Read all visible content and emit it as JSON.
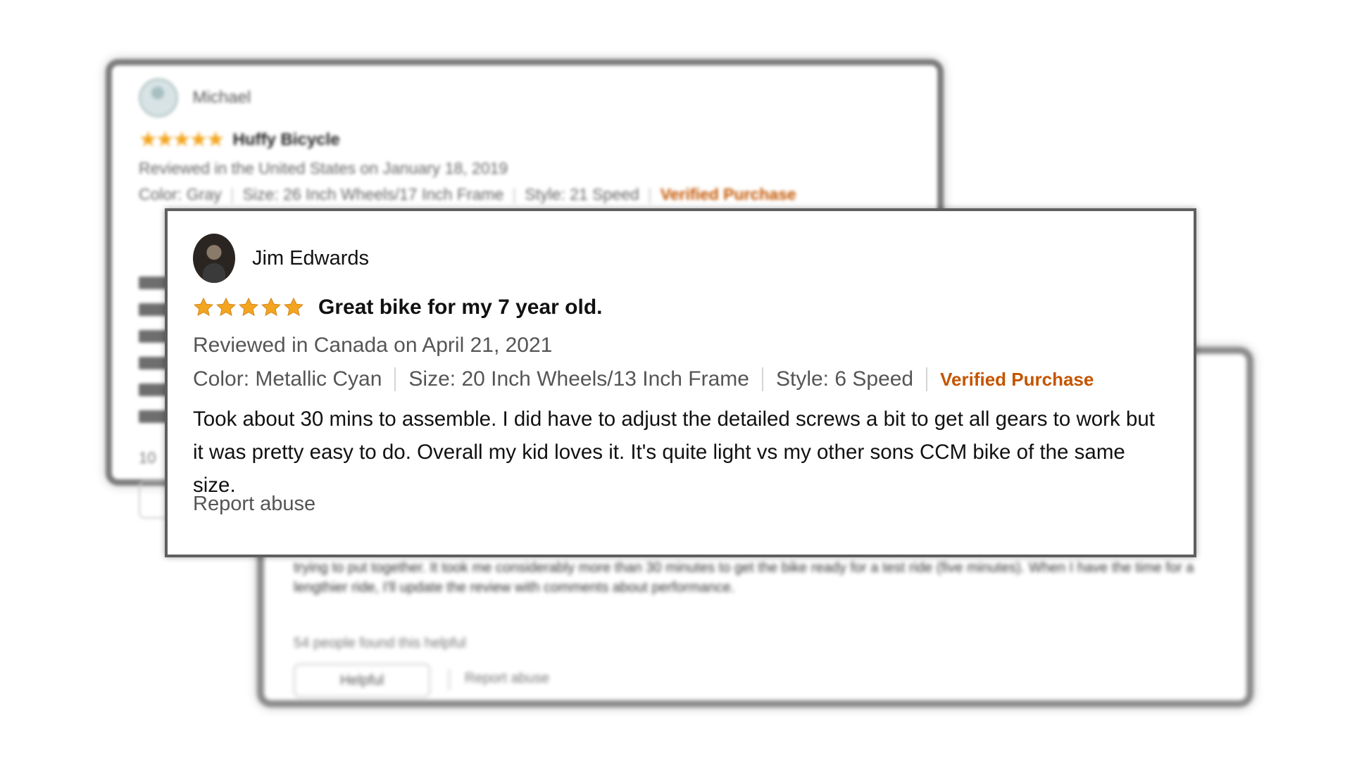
{
  "background_reviews": {
    "left": {
      "reviewer": "Michael",
      "stars": "★★★★★",
      "title": "Huffy Bicycle",
      "date": "Reviewed in the United States on January 18, 2019",
      "color": "Color: Gray",
      "size": "Size: 26 Inch Wheels/17 Inch Frame",
      "style": "Style: 21 Speed",
      "verified": "Verified Purchase",
      "helpful_count": "10"
    },
    "right": {
      "body": "trying to put together. It took me considerably more than 30 minutes to get the bike ready for a test ride (five minutes). When I have the time for a lengthier ride, I'll update the review with comments about performance.",
      "helpful_count": "54 people found this helpful",
      "helpful_button": "Helpful",
      "report": "Report abuse"
    }
  },
  "review": {
    "reviewer_name": "Jim Edwards",
    "rating": 5,
    "title": "Great bike for my 7 year old.",
    "date": "Reviewed in Canada on April 21, 2021",
    "color": "Color: Metallic Cyan",
    "size": "Size: 20 Inch Wheels/13 Inch Frame",
    "style": "Style: 6 Speed",
    "verified": "Verified Purchase",
    "body": "Took about 30 mins to assemble. I did have to adjust the detailed screws a bit to get all gears to work but it was pretty easy to do. Overall my kid loves it. It's quite light vs my other sons CCM bike of the same size.",
    "report": "Report abuse"
  },
  "colors": {
    "star": "#f3a520",
    "verified": "#c45500",
    "text": "#111111",
    "muted": "#555555"
  },
  "icons": {
    "star": "star-icon",
    "avatar": "avatar-icon"
  }
}
